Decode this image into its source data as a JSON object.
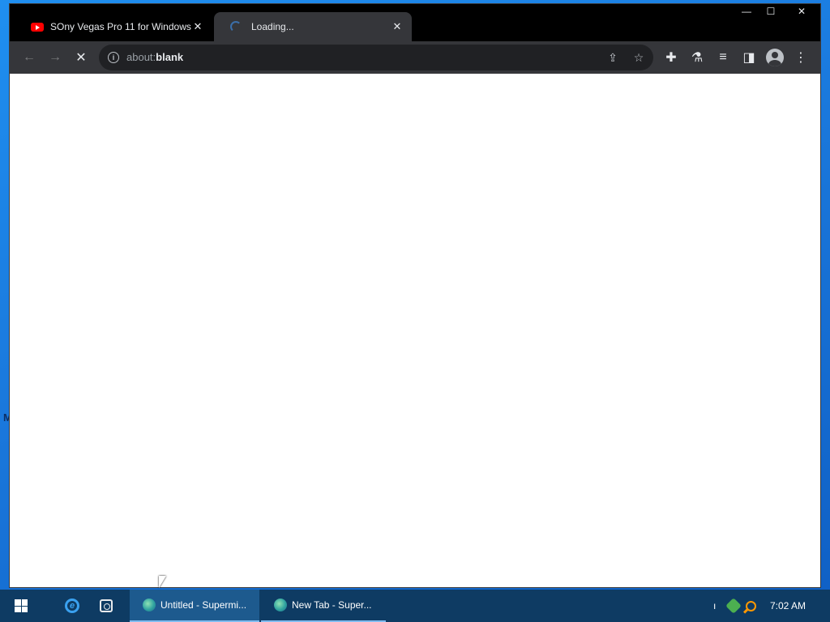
{
  "desktop": {
    "edge_letter": "M"
  },
  "browser": {
    "tabs": [
      {
        "title": "SOny Vegas Pro 11 for Windows",
        "close": "✕",
        "icon": "youtube-icon"
      },
      {
        "title": "Loading...",
        "close": "✕",
        "icon": "loading-spinner-icon"
      }
    ],
    "window_controls": {
      "minimize": "—",
      "maximize": "☐",
      "close": "✕"
    },
    "toolbar": {
      "back": "←",
      "forward": "→",
      "stop": "✕",
      "url_prefix": "about:",
      "url_host": "blank",
      "share": "⇪",
      "bookmark": "☆",
      "extensions": "✚",
      "labs": "⚗",
      "media": "≡",
      "side_panel": "◨",
      "menu": "⋮"
    },
    "colors": {
      "frame": "#000000",
      "toolbar": "#35363a",
      "omnibox": "#202124",
      "page": "#ffffff"
    }
  },
  "taskbar": {
    "items": [
      {
        "label": "Untitled - Supermi...",
        "icon": "supermium-icon",
        "state": "active"
      },
      {
        "label": "New Tab - Super...",
        "icon": "supermium-icon",
        "state": "open"
      }
    ],
    "tray_text": "ı",
    "clock": "7:02 AM",
    "colors": {
      "bar": "#0e3b63",
      "active": "#1d5a8e"
    }
  }
}
